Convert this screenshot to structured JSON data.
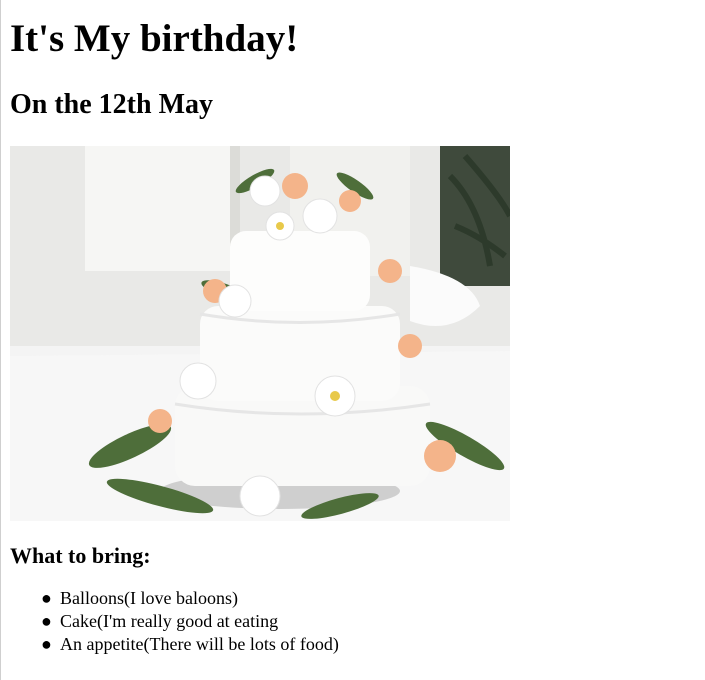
{
  "page": {
    "title": "It's My birthday!",
    "date_heading": "On the 12th May",
    "image": {
      "subject": "three-tier white cake with flowers"
    },
    "bring_heading": "What to bring:",
    "bring_items": [
      "Balloons(I love baloons)",
      "Cake(I'm really good at eating",
      "An appetite(There will be lots of food)"
    ]
  }
}
